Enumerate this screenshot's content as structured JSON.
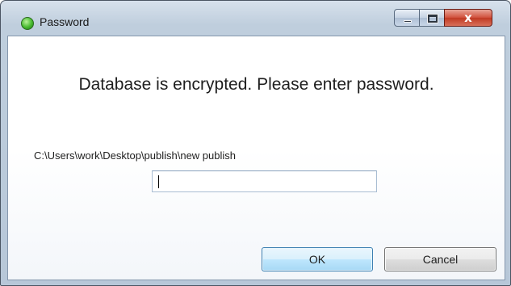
{
  "window": {
    "title": "Password",
    "app_icon": "green-circle-icon",
    "caption_buttons": {
      "minimize": "minimize-icon",
      "maximize": "maximize-icon",
      "close_glyph": "x"
    }
  },
  "dialog": {
    "message": "Database is encrypted. Please enter password.",
    "path": "C:\\Users\\work\\Desktop\\publish\\new publish",
    "password": {
      "value": "",
      "placeholder": ""
    },
    "ok_label": "OK",
    "cancel_label": "Cancel"
  },
  "colors": {
    "accent_button_border": "#3c7fb1",
    "close_button": "#c03a23",
    "frame": "#b7c7d8"
  }
}
